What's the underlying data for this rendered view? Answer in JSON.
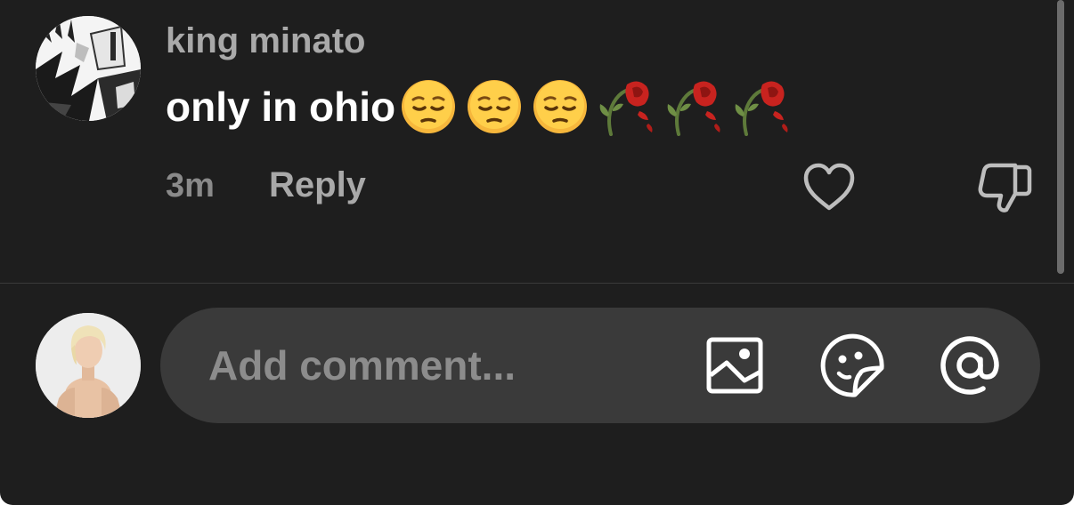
{
  "comment": {
    "username": "king minato",
    "text": "only in ohio",
    "emojis": [
      "pensive-face",
      "pensive-face",
      "pensive-face",
      "wilted-rose",
      "wilted-rose",
      "wilted-rose"
    ],
    "time": "3m",
    "reply_label": "Reply",
    "icons": {
      "like": "heart-icon",
      "dislike": "thumbs-down-icon"
    }
  },
  "composer": {
    "placeholder": "Add comment...",
    "icons": {
      "image": "image-icon",
      "sticker": "sticker-icon",
      "mention": "at-icon"
    }
  },
  "colors": {
    "background": "#1e1e1e",
    "input_background": "#3a3a3a",
    "username": "#a9a9a9",
    "comment_text": "#ffffff",
    "muted": "#8a8a8a"
  }
}
